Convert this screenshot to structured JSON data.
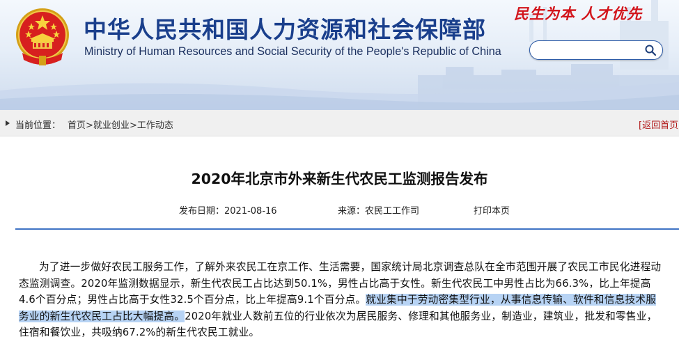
{
  "header": {
    "title_cn": "中华人民共和国人力资源和社会保障部",
    "title_en": "Ministry of Human Resources and Social Security of the People's Republic of China",
    "slogan": "民生为本 人才优先",
    "search": {
      "value": "",
      "placeholder": ""
    }
  },
  "breadcrumb": {
    "label": "当前位置：",
    "items": [
      "首页",
      "就业创业",
      "工作动态"
    ],
    "separator": ">",
    "back_home": "[返回首页"
  },
  "article": {
    "title": "2020年北京市外来新生代农民工监测报告发布",
    "date_label": "发布日期：",
    "date": "2021-08-16",
    "source_label": "来源：",
    "source": "农民工工作司",
    "print_label": "打印本页",
    "body_before": "为了进一步做好农民工服务工作，了解外来农民工在京工作、生活需要，国家统计局北京调查总队在全市范围开展了农民工市民化进程动态监测调查。2020年监测数据显示，新生代农民工占比达到50.1%，男性占比高于女性。新生代农民工中男性占比为66.3%，比上年提高4.6个百分点；男性占比高于女性32.5个百分点，比上年提高9.1个百分点。",
    "body_highlight": "就业集中于劳动密集型行业，从事信息传输、软件和信息技术服务业的新生代农民工占比大幅提高。",
    "body_after": "2020年就业人数前五位的行业依次为居民服务、修理和其他服务业，制造业，建筑业，批发和零售业，住宿和餐饮业，共吸纳67.2%的新生代农民工就业。"
  },
  "colors": {
    "title_blue": "#1a3f8c",
    "slogan_red": "#d2141b",
    "divider_blue": "#3f73c4",
    "highlight": "#b7d3f4",
    "back_home_red": "#b01818"
  },
  "icons": [
    "national-emblem-icon",
    "search-icon",
    "breadcrumb-arrow-icon"
  ]
}
